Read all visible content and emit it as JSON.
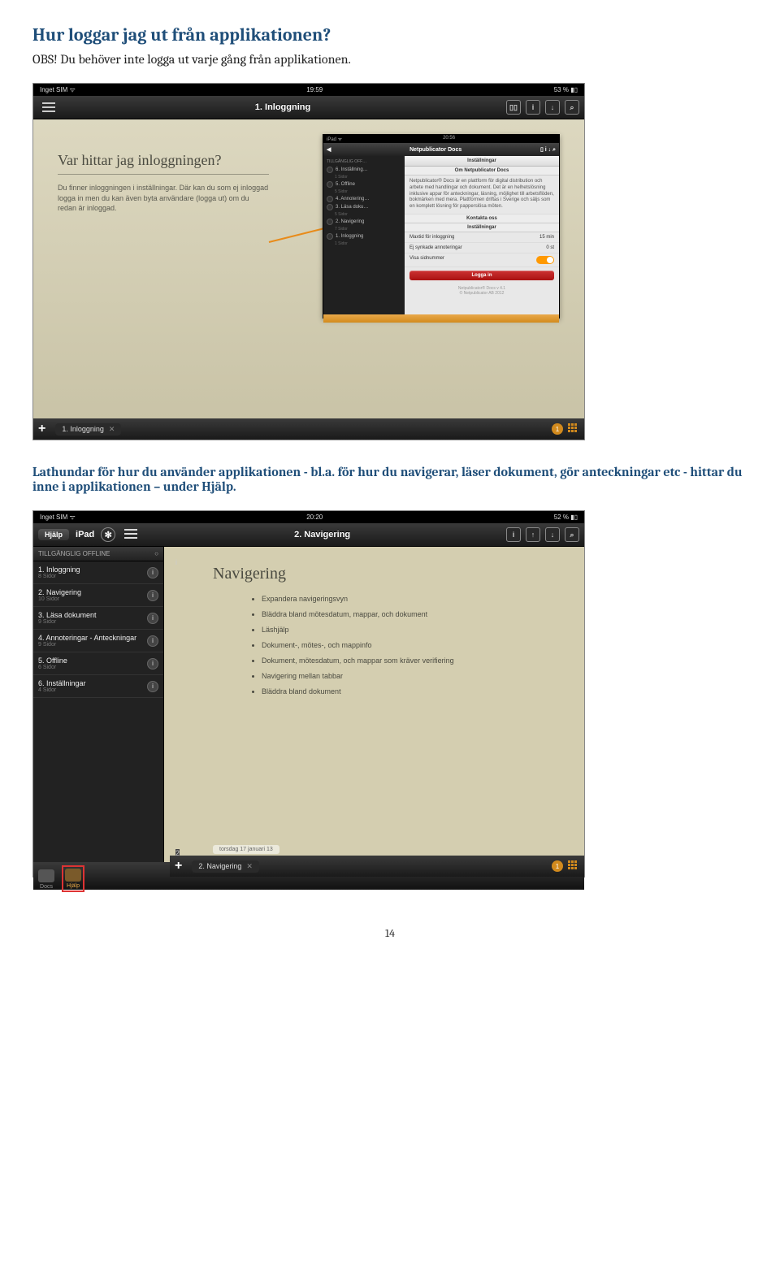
{
  "doc": {
    "heading1": "Hur loggar jag ut från applikationen?",
    "para1": "OBS! Du behöver inte logga ut varje gång från applikationen.",
    "heading2": "Lathundar för hur du använder applikationen - bl.a. för hur du navigerar, läser dokument, gör anteckningar etc - hittar du inne i applikationen – under Hjälp.",
    "page_number": "14"
  },
  "ss1": {
    "status": {
      "left": "Inget SIM ᯤ",
      "center": "19:59",
      "right": "53 % ▮▯"
    },
    "nav": {
      "title": "1. Inloggning",
      "right_icons": [
        "bookmarks-icon",
        "info-icon",
        "download-icon",
        "search-icon"
      ]
    },
    "paper": {
      "title": "Var hittar jag inloggningen?",
      "body": "Du finner inloggningen i inställningar. Där kan du som ej inloggad logga in men du kan även byta användare (logga ut) om du redan är inloggad."
    },
    "nested": {
      "status": {
        "left": "iPad ᯤ",
        "center": "20:56",
        "right": ""
      },
      "nav": {
        "back": "◀",
        "title": "Netpublicator Docs",
        "right": ""
      },
      "sidebar_header": "TILLGÄNGLIG OFF…",
      "sidebar_items": [
        {
          "title": "6. Inställning…",
          "sub": "1 Sidor"
        },
        {
          "title": "5. Offline",
          "sub": "5 Sidor"
        },
        {
          "title": "4. Annotering…",
          "sub": ""
        },
        {
          "title": "3. Läsa doku…",
          "sub": "5 Sidor"
        },
        {
          "title": "2. Navigering",
          "sub": "7 Sidor"
        },
        {
          "title": "1. Inloggning",
          "sub": "1 Sidor"
        }
      ],
      "panel": {
        "header": "Inställningar",
        "section1_title": "Om Netpublicator Docs",
        "section1_body": "Netpublicator® Docs är en plattform för digital distribution och arbete med handlingar och dokument. Det är en helhetslösning inklusive appar för anteckningar, läsning, möjlighet till arbetsflöden, bokmärken med mera. Plattformen driftas i Sverige och säljs som en komplett lösning för papperslösa möten.",
        "contact_label": "Kontakta oss",
        "settings_header": "Inställningar",
        "rows": [
          {
            "label": "Maxtid för inloggning",
            "value": "15 min"
          },
          {
            "label": "Ej synkade annoteringar",
            "value": "0 st"
          },
          {
            "label": "Visa sidnummer",
            "toggle": true
          }
        ],
        "login_button": "Logga in",
        "footer1": "Netpublicator® Docs v 4.1",
        "footer2": "© Netpublicator AB 2012"
      }
    },
    "bottom": {
      "tab_label": "1. Inloggning",
      "badge": "1"
    }
  },
  "ss2": {
    "status": {
      "left": "Inget SIM ᯤ",
      "center": "20:20",
      "right": "52 % ▮▯"
    },
    "nav": {
      "back": "Hjälp",
      "device": "iPad",
      "title": "2. Navigering",
      "right_icons": [
        "info-icon",
        "up-icon",
        "download-icon",
        "search-icon"
      ]
    },
    "sidebar": {
      "header_left": "TILLGÄNGLIG OFFLINE",
      "header_right": "○",
      "items": [
        {
          "title": "1. Inloggning",
          "sub": "8 Sidor"
        },
        {
          "title": "2. Navigering",
          "sub": "10 Sidor"
        },
        {
          "title": "3. Läsa dokument",
          "sub": "9 Sidor"
        },
        {
          "title": "4. Annoteringar - Anteckningar",
          "sub": "9 Sidor"
        },
        {
          "title": "5. Offline",
          "sub": "6 Sidor"
        },
        {
          "title": "6. Inställningar",
          "sub": "4 Sidor"
        }
      ]
    },
    "main": {
      "title": "Navigering",
      "bullets": [
        "Expandera navigeringsvyn",
        "Bläddra bland mötesdatum, mappar, och dokument",
        "Läshjälp",
        "Dokument-, mötes-, och mappinfo",
        "Dokument, mötesdatum, och mappar som kräver verifiering",
        "Navigering mellan tabbar",
        "Bläddra bland dokument"
      ],
      "date_bar": "torsdag 17 januari 13",
      "page_badge": "2"
    },
    "dock": {
      "items": [
        {
          "label": "Docs",
          "name": "dock-docs"
        },
        {
          "label": "Hjälp",
          "name": "dock-help",
          "active": true,
          "boxed": true
        }
      ]
    },
    "bottom": {
      "tab_label": "2. Navigering",
      "badge": "1"
    }
  }
}
